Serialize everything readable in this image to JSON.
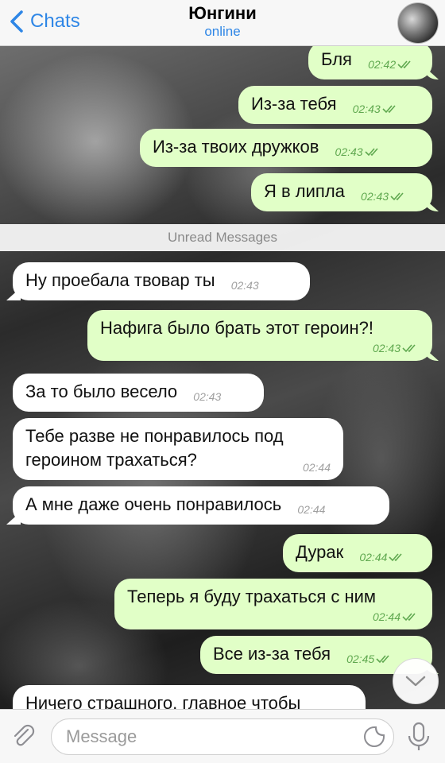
{
  "header": {
    "back_label": "Chats",
    "title": "Юнгини",
    "status": "online"
  },
  "unread_label": "Unread Messages",
  "messages": [
    {
      "dir": "out",
      "text": "Бля",
      "time": "02:42"
    },
    {
      "dir": "out",
      "text": "Из-за тебя",
      "time": "02:43"
    },
    {
      "dir": "out",
      "text": "Из-за твоих дружков",
      "time": "02:43"
    },
    {
      "dir": "out",
      "text": "Я в липла",
      "time": "02:43"
    },
    {
      "dir": "in",
      "text": "Ну проебала твовар ты",
      "time": "02:43"
    },
    {
      "dir": "out",
      "text": "Нафига было брать этот героин?!",
      "time": "02:43"
    },
    {
      "dir": "in",
      "text": "За то было весело",
      "time": "02:43"
    },
    {
      "dir": "in",
      "text": "Тебе разве не понравилось под героином трахаться?",
      "time": "02:44"
    },
    {
      "dir": "in",
      "text": "А мне даже очень понравилось",
      "time": "02:44"
    },
    {
      "dir": "out",
      "text": "Дурак",
      "time": "02:44"
    },
    {
      "dir": "out",
      "text": "Теперь я буду трахаться с ним",
      "time": "02:44"
    },
    {
      "dir": "out",
      "text": "Все из-за тебя",
      "time": "02:45"
    },
    {
      "dir": "in",
      "text": "Ничего страшного, главное чтобы",
      "time": ""
    }
  ],
  "input": {
    "placeholder": "Message"
  },
  "icons": {
    "back": "chevron-left-icon",
    "attach": "paperclip-icon",
    "sticker": "sticker-icon",
    "mic": "microphone-icon",
    "scroll": "chevron-down-icon",
    "read": "double-check-icon"
  },
  "colors": {
    "accent": "#2e86e6",
    "outgoing_bubble": "#e1ffc7",
    "incoming_bubble": "#ffffff",
    "outgoing_time": "#5fa84f"
  }
}
